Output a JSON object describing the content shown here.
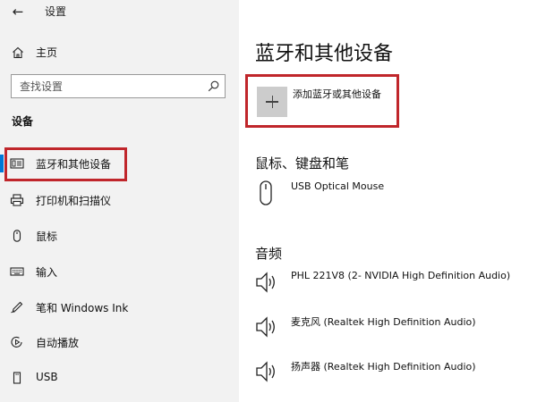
{
  "window": {
    "title": "设置",
    "back_icon": "back-arrow-icon"
  },
  "sidebar": {
    "home_label": "主页",
    "search_placeholder": "查找设置",
    "section_label": "设备",
    "items": [
      {
        "label": "蓝牙和其他设备",
        "icon": "bluetooth-devices-icon",
        "active": true
      },
      {
        "label": "打印机和扫描仪",
        "icon": "printer-icon",
        "active": false
      },
      {
        "label": "鼠标",
        "icon": "mouse-icon",
        "active": false
      },
      {
        "label": "输入",
        "icon": "keyboard-icon",
        "active": false
      },
      {
        "label": "笔和 Windows Ink",
        "icon": "pen-icon",
        "active": false
      },
      {
        "label": "自动播放",
        "icon": "autoplay-icon",
        "active": false
      },
      {
        "label": "USB",
        "icon": "usb-icon",
        "active": false
      }
    ]
  },
  "main": {
    "title": "蓝牙和其他设备",
    "add_device_label": "添加蓝牙或其他设备",
    "mouse_section": {
      "heading": "鼠标、键盘和笔",
      "devices": [
        {
          "label": "USB Optical Mouse",
          "icon": "mouse-icon"
        }
      ]
    },
    "audio_section": {
      "heading": "音频",
      "devices": [
        {
          "label": "PHL 221V8 (2- NVIDIA High Definition Audio)",
          "icon": "speaker-icon"
        },
        {
          "label": "麦克风 (Realtek High Definition Audio)",
          "icon": "speaker-icon"
        },
        {
          "label": "扬声器 (Realtek High Definition Audio)",
          "icon": "speaker-icon"
        }
      ]
    }
  },
  "colors": {
    "sidebar_bg": "#f2f2f2",
    "accent": "#0078d7",
    "highlight": "#c0262b"
  }
}
